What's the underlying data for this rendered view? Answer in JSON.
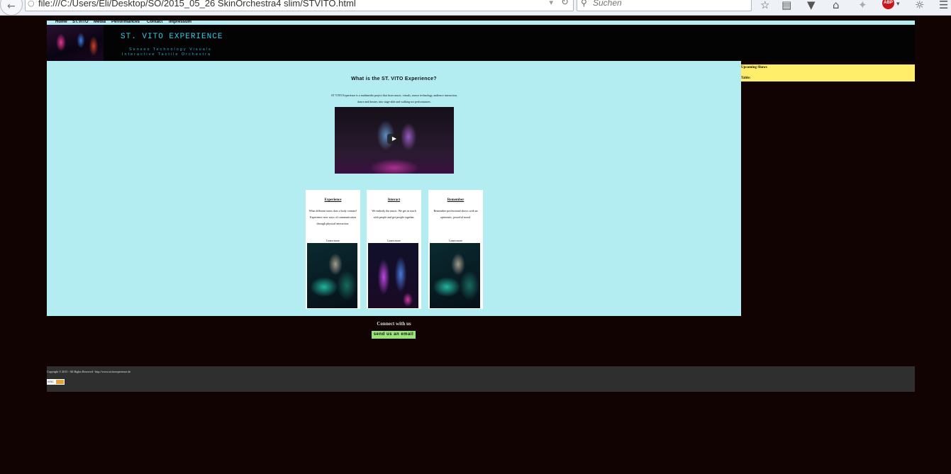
{
  "browser": {
    "url": "file:///C:/Users/Eli/Desktop/SO/2015_05_26 SkinOrchestra4 slim/STVITO.html",
    "search_placeholder": "Suchen",
    "abp_label": "ABP"
  },
  "nav": {
    "items": [
      "Home",
      "ST.VITO",
      "Media",
      "Performances",
      "Contact",
      "Impressum"
    ]
  },
  "header": {
    "title": "ST. VITO EXPERIENCE",
    "tagline_line1": "Senses Technology Visuals",
    "tagline_line2": "Interactive Tactile Orchestra"
  },
  "main": {
    "heading": "What is the ST. VITO Experience?",
    "intro": "ST VITO Experience is a multimedia project that fuses music, visuals, sensor technology, audience interaction, dance and theater, into stage-able and walking-act performances."
  },
  "cards": [
    {
      "title": "Experience",
      "text": "What different tones does a body contain? Experience new ways of communication through physical interaction.",
      "link": "Learn more"
    },
    {
      "title": "Interact",
      "text": "We embody the music. We get in touch with people and get people together.",
      "link": "Learn more"
    },
    {
      "title": "Remember",
      "text": "Remember professional shows with an optimistic, peaceful mood.",
      "link": "Learn more"
    }
  ],
  "sidebar": {
    "heading": "Upcoming Shows",
    "table_label": "Table:"
  },
  "contact": {
    "heading": "Connect with us",
    "email_button": "send us an email"
  },
  "footer": {
    "copyright": "Copyright © 2015 - All Rights Reserved - http://www.stvitoexperience.de",
    "badge": "W3C"
  }
}
